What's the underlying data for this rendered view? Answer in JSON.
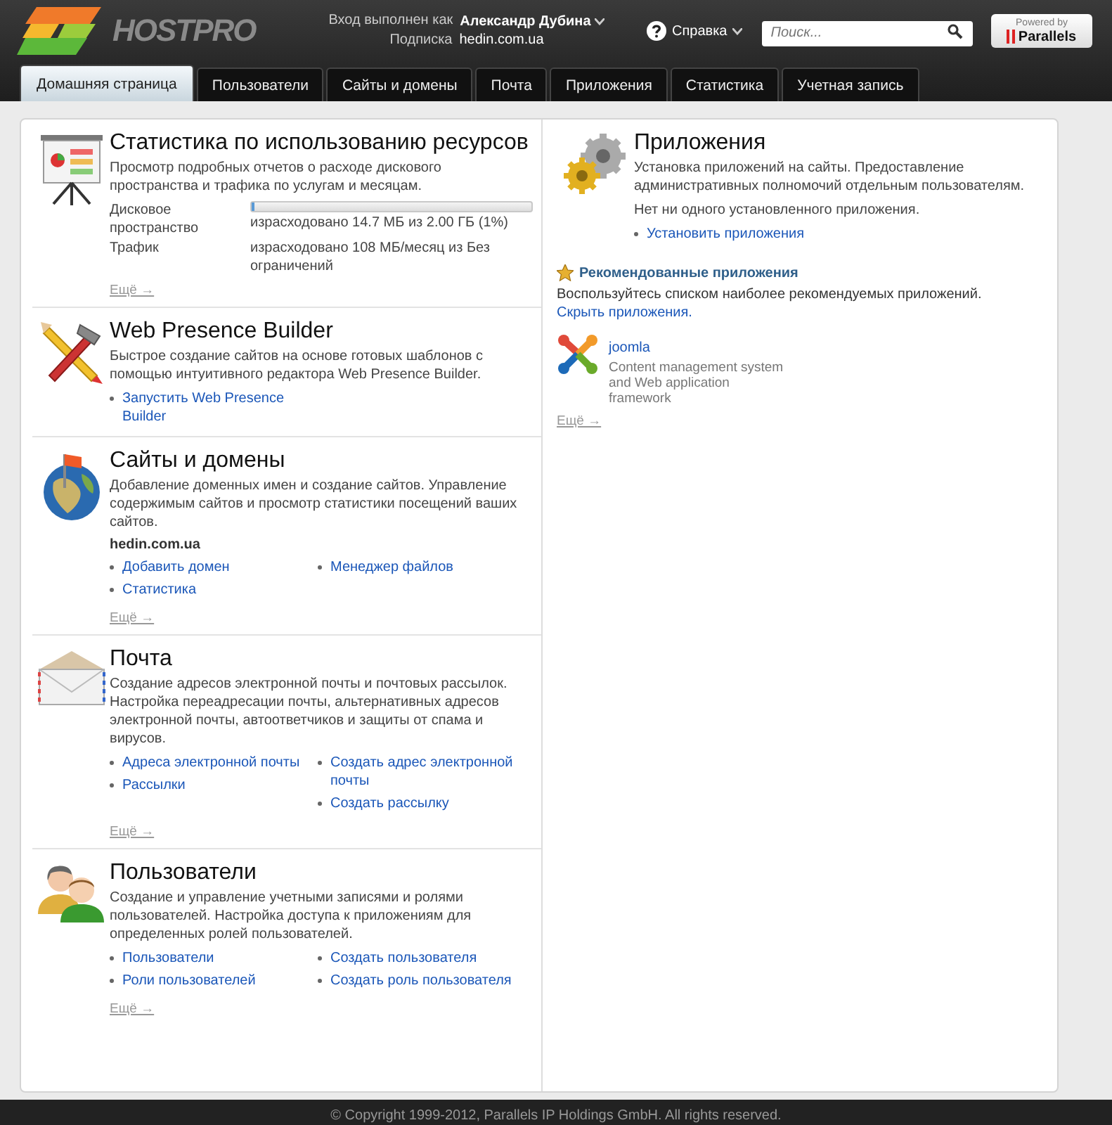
{
  "header": {
    "logo_text": "HOSTPRO",
    "login_label": "Вход выполнен как",
    "user_name": "Александр Дубина",
    "subscription_label": "Подписка",
    "subscription": "hedin.com.ua",
    "help": "Справка",
    "search": {
      "placeholder": "Поиск..."
    },
    "powered_by": "Powered by",
    "vendor": "Parallels"
  },
  "tabs": [
    {
      "label": "Домашняя страница",
      "selected": true
    },
    {
      "label": "Пользователи",
      "selected": false
    },
    {
      "label": "Сайты и домены",
      "selected": false
    },
    {
      "label": "Почта",
      "selected": false
    },
    {
      "label": "Приложения",
      "selected": false
    },
    {
      "label": "Статистика",
      "selected": false
    },
    {
      "label": "Учетная запись",
      "selected": false
    }
  ],
  "sections": [
    {
      "kind": "stats",
      "title": "Статистика по использованию ресурсов",
      "description": "Просмотр подробных отчетов о расходе дискового пространства и трафика по услугам и месяцам.",
      "stats": [
        {
          "label": "Дисковое пространство",
          "reading": "израсходовано 14.7 МБ из 2.00 ГБ (1%)",
          "level": 0.01
        },
        {
          "label": "Трафик",
          "reading": "израсходовано 108 МБ/месяц из Без ограничений"
        }
      ],
      "more": "Ещё →"
    },
    {
      "kind": "builder",
      "title": "Web Presence Builder",
      "description": "Быстрое создание сайтов на основе готовых шаблонов с помощью интуитивного редактора Web Presence Builder.",
      "link_columns": [
        {
          "links": [
            "Запустить Web Presence Builder"
          ]
        }
      ]
    },
    {
      "kind": "domains",
      "title": "Сайты и домены",
      "description": "Добавление доменных имен и создание сайтов. Управление содержимым сайтов и просмотр статистики посещений ваших сайтов.",
      "domain": "hedin.com.ua",
      "link_columns": [
        {
          "links": [
            "Добавить домен",
            "Статистика"
          ]
        },
        {
          "links": [
            "Менеджер файлов"
          ]
        }
      ],
      "more": "Ещё →"
    },
    {
      "kind": "mail",
      "title": "Почта",
      "description": "Создание адресов электронной почты и почтовых рассылок. Настройка переадресации почты, альтернативных адресов электронной почты, автоответчиков и защиты от спама и вирусов.",
      "link_columns": [
        {
          "links": [
            "Адреса электронной почты",
            "Рассылки"
          ]
        },
        {
          "links": [
            "Создать адрес электронной почты",
            "Создать рассылку"
          ]
        }
      ],
      "more": "Ещё →"
    },
    {
      "kind": "users",
      "title": "Пользователи",
      "description": "Создание и управление учетными записями и ролями пользователей. Настройка доступа к приложениям для определенных ролей пользователей.",
      "link_columns": [
        {
          "links": [
            "Пользователи",
            "Роли пользователей"
          ]
        },
        {
          "links": [
            "Создать пользователя",
            "Создать роль пользователя"
          ]
        }
      ],
      "more": "Ещё →"
    }
  ],
  "apps": {
    "title": "Приложения",
    "description": "Установка приложений на сайты. Предоставление административных полномочий отдельным пользователям.",
    "note": "Нет ни одного установленного приложения.",
    "links": [
      "Установить приложения"
    ],
    "recommended": {
      "title": "Рекомендованные приложения",
      "text": "Воспользуйтесь списком наиболее рекомендуемых приложений.",
      "hide_link": "Скрыть приложения.",
      "items": [
        {
          "name": "joomla",
          "description": "Content management system and Web application framework"
        }
      ]
    },
    "more": "Ещё →"
  },
  "footer": "© Copyright 1999-2012, Parallels IP Holdings GmbH. All rights reserved."
}
